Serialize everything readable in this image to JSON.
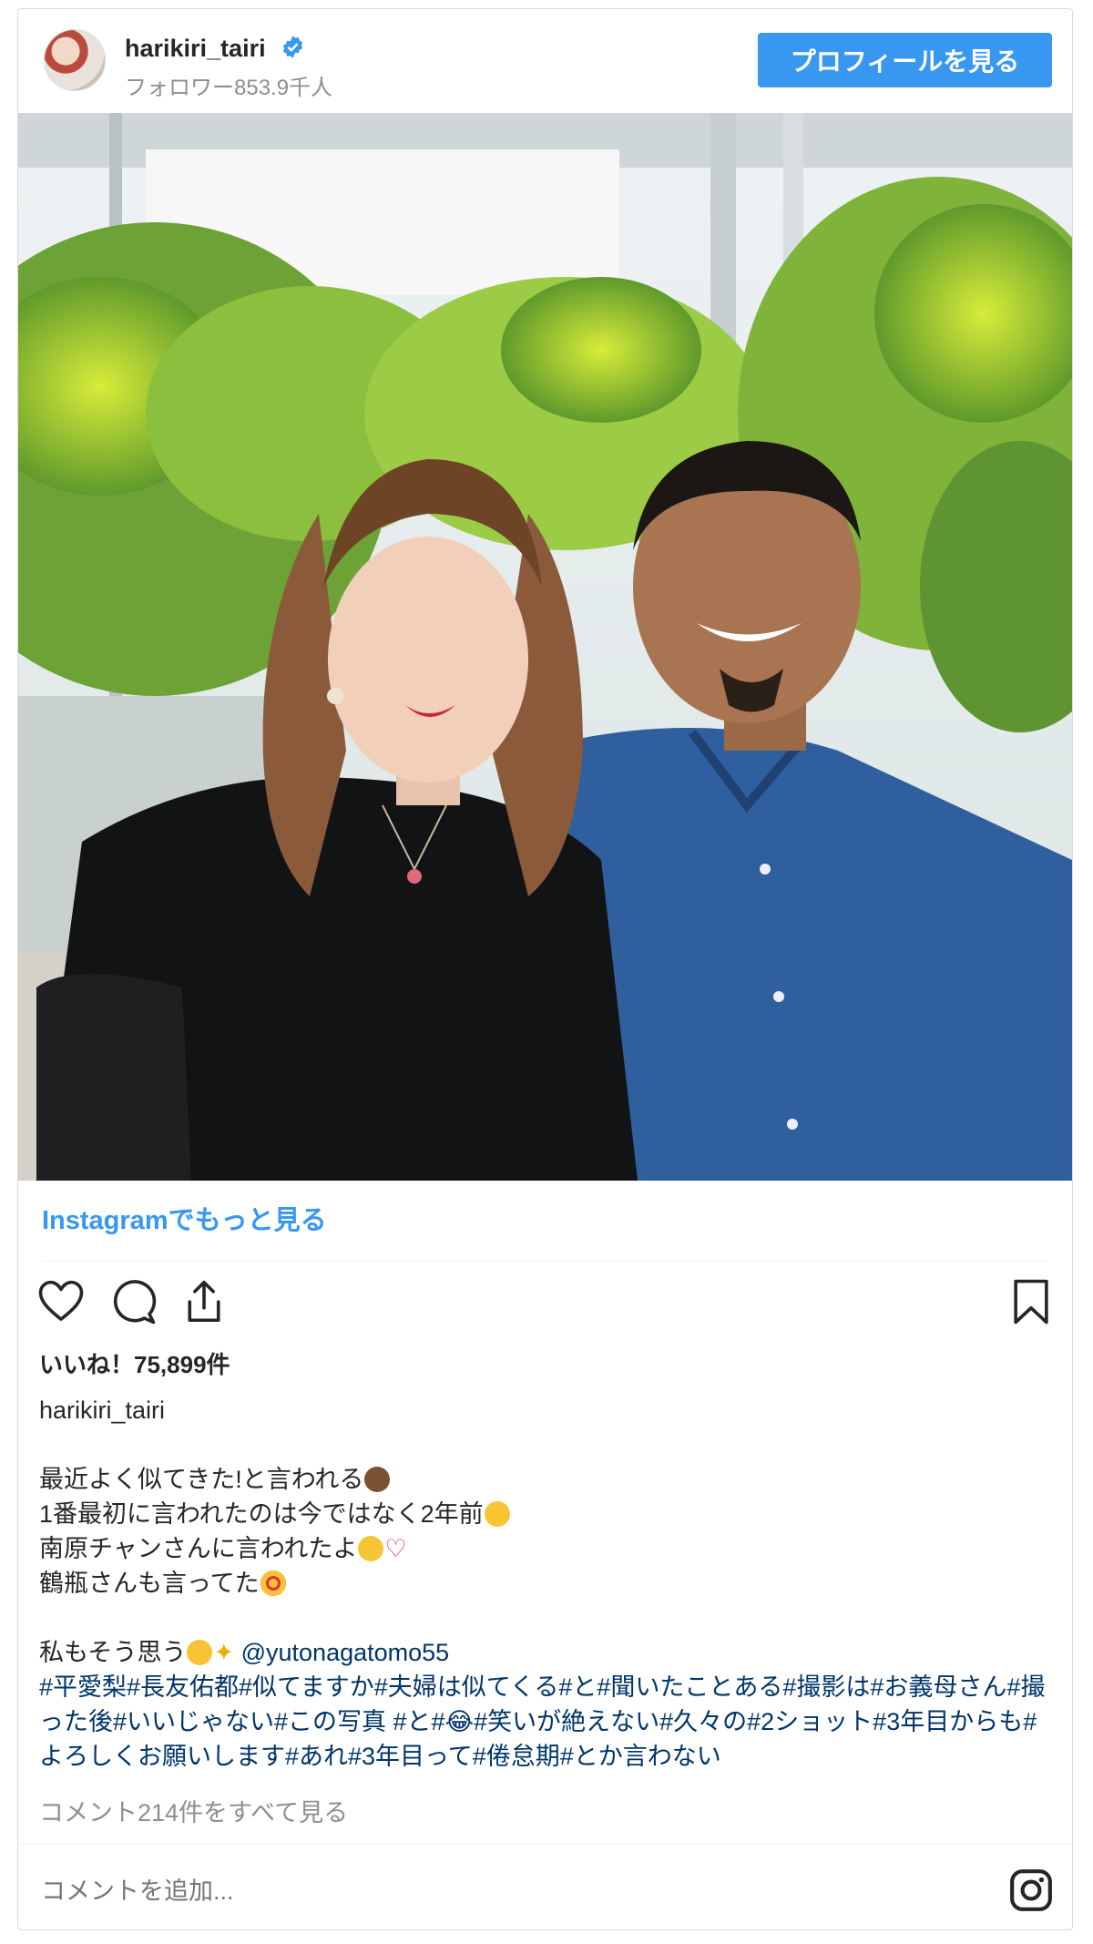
{
  "header": {
    "username": "harikiri_tairi",
    "followers": "フォロワー853.9千人",
    "profile_button": "プロフィールを見る"
  },
  "more_link": "Instagramでもっと見る",
  "likes": "いいね！75,899件",
  "poster": "harikiri_tairi",
  "caption": {
    "line1": "最近よく似てきた!と言われる",
    "line2": "1番最初に言われたのは今ではなく2年前",
    "line3": "南原チャンさんに言われたよ",
    "line4": "鶴瓶さんも言ってた",
    "line5": "私もそう思う",
    "mention": "@yutonagatomo55",
    "hashtags": "#平愛梨#長友佑都#似てますか#夫婦は似てくる#と#聞いたことある#撮影は#お義母さん#撮った後#いいじゃない#この写真 #と#😂#笑いが絶えない#久々の#2ショット#3年目からも#よろしくお願いします#あれ#3年目って#倦怠期#とか言わない"
  },
  "comments_link": "コメント214件をすべて見る",
  "add_comment_placeholder": "コメントを追加...",
  "colors": {
    "accent": "#3897f0",
    "hashtag": "#003569",
    "muted": "#8e8e8e"
  },
  "icons": [
    "verified-badge-icon",
    "heart-icon",
    "comment-icon",
    "share-icon",
    "bookmark-icon",
    "instagram-logo-icon"
  ]
}
